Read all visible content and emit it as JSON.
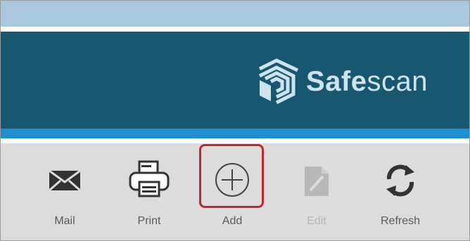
{
  "app": {
    "brand_bold": "Safe",
    "brand_light": "scan"
  },
  "toolbar": {
    "items": [
      {
        "label": "Mail",
        "icon": "mail-icon",
        "enabled": true
      },
      {
        "label": "Print",
        "icon": "printer-icon",
        "enabled": true
      },
      {
        "label": "Add",
        "icon": "plus-circle-icon",
        "enabled": true,
        "highlighted": true
      },
      {
        "label": "Edit",
        "icon": "edit-document-icon",
        "enabled": false
      },
      {
        "label": "Refresh",
        "icon": "refresh-icon",
        "enabled": true
      }
    ]
  },
  "colors": {
    "top_strip": "#a9c8dc",
    "banner": "#17576f",
    "accent_bar": "#1f8ed0",
    "toolbar_bg": "#dcdcdc",
    "highlight": "#c1272d",
    "logo": "#cfe3ee"
  }
}
